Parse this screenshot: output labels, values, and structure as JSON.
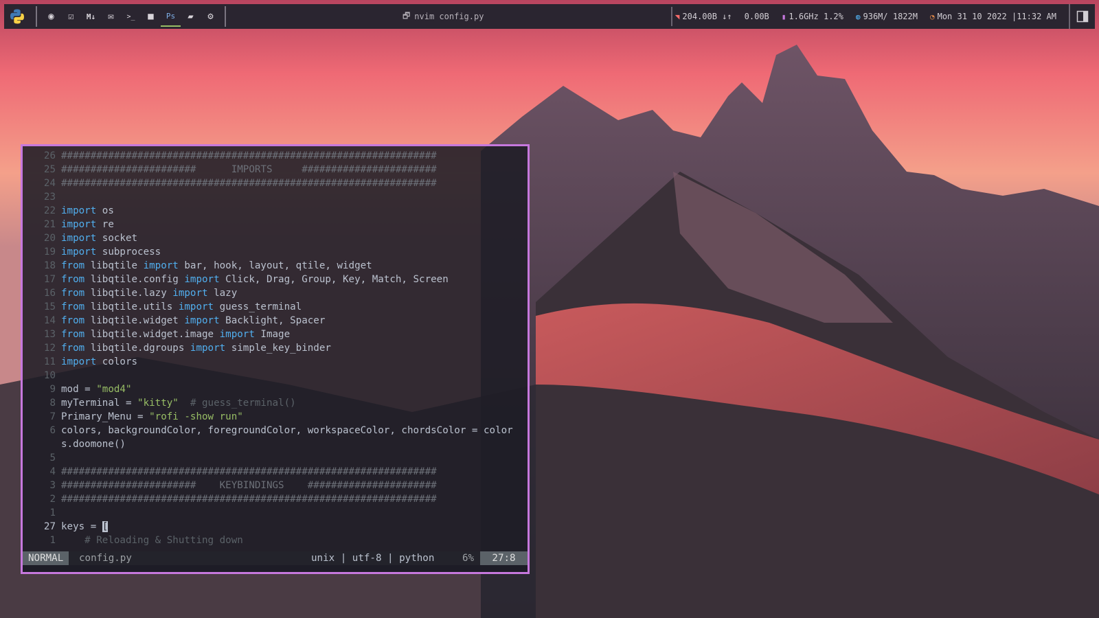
{
  "colors": {
    "bar_bg": "#2a2530",
    "accent_border": "#c678dd",
    "keyword": "#51afef",
    "string": "#98be65",
    "comment": "#5b6268",
    "text": "#bbc2cf"
  },
  "topbar": {
    "launchers": [
      {
        "name": "firefox-icon",
        "glyph": "◉"
      },
      {
        "name": "tasks-icon",
        "glyph": "☑"
      },
      {
        "name": "markdown-icon",
        "glyph": "M↓"
      },
      {
        "name": "mail-icon",
        "glyph": "✉"
      },
      {
        "name": "terminal-icon",
        "glyph": ">_"
      },
      {
        "name": "video-icon",
        "glyph": "■"
      },
      {
        "name": "photoshop-icon",
        "glyph": "Ps"
      },
      {
        "name": "folder-icon",
        "glyph": "▰"
      },
      {
        "name": "settings-icon",
        "glyph": "⚙"
      }
    ],
    "window_title": "nvim config.py",
    "net_down": "204.00B ↓↑",
    "net_up": "0.00B",
    "cpu": "1.6GHz 1.2%",
    "memory": "936M/ 1822M",
    "datetime": "Mon 31 10 2022 |11:32 AM"
  },
  "editor": {
    "lines": [
      {
        "n": "26",
        "segs": [
          [
            "hash",
            "################################################################"
          ]
        ]
      },
      {
        "n": "25",
        "segs": [
          [
            "hash",
            "#######################      IMPORTS     #######################"
          ]
        ]
      },
      {
        "n": "24",
        "segs": [
          [
            "hash",
            "################################################################"
          ]
        ]
      },
      {
        "n": "23",
        "segs": []
      },
      {
        "n": "22",
        "segs": [
          [
            "kw",
            "import"
          ],
          [
            "txt",
            " os"
          ]
        ]
      },
      {
        "n": "21",
        "segs": [
          [
            "kw",
            "import"
          ],
          [
            "txt",
            " re"
          ]
        ]
      },
      {
        "n": "20",
        "segs": [
          [
            "kw",
            "import"
          ],
          [
            "txt",
            " socket"
          ]
        ]
      },
      {
        "n": "19",
        "segs": [
          [
            "kw",
            "import"
          ],
          [
            "txt",
            " subprocess"
          ]
        ]
      },
      {
        "n": "18",
        "segs": [
          [
            "kw",
            "from"
          ],
          [
            "txt",
            " libqtile "
          ],
          [
            "kw",
            "import"
          ],
          [
            "txt",
            " bar, hook, layout, qtile, widget"
          ]
        ]
      },
      {
        "n": "17",
        "segs": [
          [
            "kw",
            "from"
          ],
          [
            "txt",
            " libqtile.config "
          ],
          [
            "kw",
            "import"
          ],
          [
            "txt",
            " Click, Drag, Group, Key, Match, Screen"
          ]
        ]
      },
      {
        "n": "16",
        "segs": [
          [
            "kw",
            "from"
          ],
          [
            "txt",
            " libqtile.lazy "
          ],
          [
            "kw",
            "import"
          ],
          [
            "txt",
            " lazy"
          ]
        ]
      },
      {
        "n": "15",
        "segs": [
          [
            "kw",
            "from"
          ],
          [
            "txt",
            " libqtile.utils "
          ],
          [
            "kw",
            "import"
          ],
          [
            "txt",
            " guess_terminal"
          ]
        ]
      },
      {
        "n": "14",
        "segs": [
          [
            "kw",
            "from"
          ],
          [
            "txt",
            " libqtile.widget "
          ],
          [
            "kw",
            "import"
          ],
          [
            "txt",
            " Backlight, Spacer"
          ]
        ]
      },
      {
        "n": "13",
        "segs": [
          [
            "kw",
            "from"
          ],
          [
            "txt",
            " libqtile.widget.image "
          ],
          [
            "kw",
            "import"
          ],
          [
            "txt",
            " Image"
          ]
        ]
      },
      {
        "n": "12",
        "segs": [
          [
            "kw",
            "from"
          ],
          [
            "txt",
            " libqtile.dgroups "
          ],
          [
            "kw",
            "import"
          ],
          [
            "txt",
            " simple_key_binder"
          ]
        ]
      },
      {
        "n": "11",
        "segs": [
          [
            "kw",
            "import"
          ],
          [
            "txt",
            " colors"
          ]
        ]
      },
      {
        "n": "10",
        "segs": []
      },
      {
        "n": "9",
        "segs": [
          [
            "txt",
            "mod = "
          ],
          [
            "str",
            "\"mod4\""
          ]
        ]
      },
      {
        "n": "8",
        "segs": [
          [
            "txt",
            "myTerminal = "
          ],
          [
            "str",
            "\"kitty\""
          ],
          [
            "txt",
            "  "
          ],
          [
            "cmt",
            "# guess_terminal()"
          ]
        ]
      },
      {
        "n": "7",
        "segs": [
          [
            "txt",
            "Primary_Menu = "
          ],
          [
            "str",
            "\"rofi -show run\""
          ]
        ]
      },
      {
        "n": "6",
        "segs": [
          [
            "txt",
            "colors, backgroundColor, foregroundColor, workspaceColor, chordsColor = color"
          ]
        ]
      },
      {
        "n": "",
        "segs": [
          [
            "txt",
            "s.doomone()"
          ]
        ]
      },
      {
        "n": "5",
        "segs": []
      },
      {
        "n": "4",
        "segs": [
          [
            "hash",
            "################################################################"
          ]
        ]
      },
      {
        "n": "3",
        "segs": [
          [
            "hash",
            "#######################    KEYBINDINGS    ######################"
          ]
        ]
      },
      {
        "n": "2",
        "segs": [
          [
            "hash",
            "################################################################"
          ]
        ]
      },
      {
        "n": "1",
        "segs": []
      },
      {
        "n": "27",
        "cur": true,
        "segs": [
          [
            "txt",
            "keys = "
          ],
          [
            "cursor",
            "["
          ]
        ]
      },
      {
        "n": "1",
        "segs": [
          [
            "txt",
            "    "
          ],
          [
            "cmt",
            "# Reloading & Shutting down"
          ]
        ]
      }
    ],
    "status": {
      "mode": "NORMAL",
      "file": "config.py",
      "encoding": "unix | utf-8 | python",
      "percent": "6%",
      "position": "27:8"
    }
  }
}
